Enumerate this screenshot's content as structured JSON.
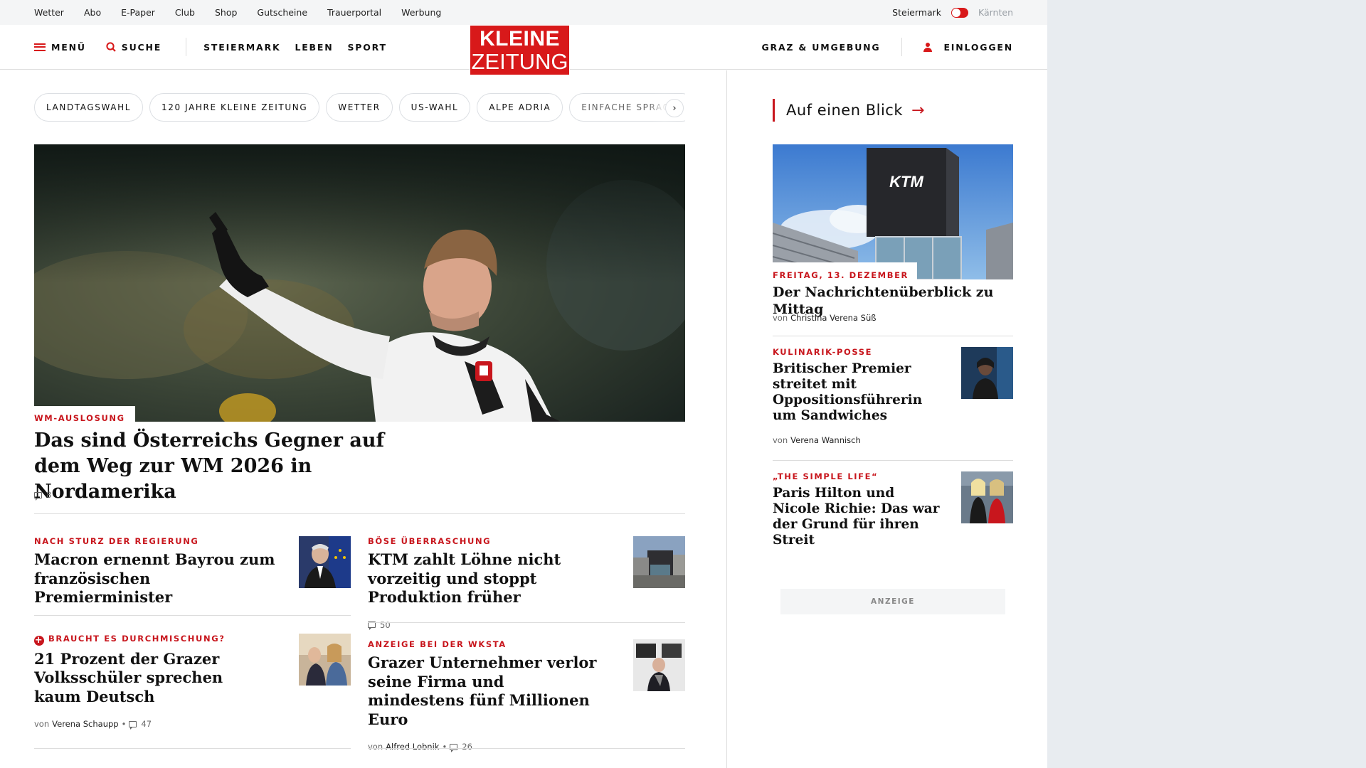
{
  "utility": {
    "links": [
      "Wetter",
      "Abo",
      "E-Paper",
      "Club",
      "Shop",
      "Gutscheine",
      "Trauerportal",
      "Werbung"
    ],
    "region_active": "Steiermark",
    "region_inactive": "Kärnten"
  },
  "header": {
    "menu_label": "MENÜ",
    "search_label": "SUCHE",
    "sections": [
      "STEIERMARK",
      "LEBEN",
      "SPORT"
    ],
    "logo_line1": "KLEINE",
    "logo_line2": "ZEITUNG",
    "region_link": "GRAZ & UMGEBUNG",
    "login_label": "EINLOGGEN"
  },
  "chips": [
    "LANDTAGSWAHL",
    "120 JAHRE KLEINE ZEITUNG",
    "WETTER",
    "US-WAHL",
    "ALPE ADRIA",
    "EINFACHE SPRACHE"
  ],
  "hero": {
    "kicker": "WM-AUSLOSUNG",
    "title": "Das sind Österreichs Gegner auf dem Weg zur WM 2026 in Nordamerika",
    "comments": "8"
  },
  "articles": [
    {
      "kicker": "NACH STURZ DER REGIERUNG",
      "title": "Macron ernennt Bayrou zum französischen Premierminister"
    },
    {
      "kicker": "BÖSE ÜBERRASCHUNG",
      "title": "KTM zahlt Löhne nicht vorzeitig und stoppt Produktion früher",
      "comments": "50"
    },
    {
      "kicker": "BRAUCHT ES DURCHMISCHUNG?",
      "title": "21 Prozent der Grazer Volksschüler sprechen kaum Deutsch",
      "by": "von",
      "author": "Verena Schaupp",
      "comments": "47"
    },
    {
      "kicker": "ANZEIGE BEI DER WKSTA",
      "title": "Grazer Unternehmer verlor seine Firma und mindestens fünf Millionen Euro",
      "by": "von",
      "author": "Alfred Lobnik",
      "comments": "26"
    }
  ],
  "sidebar": {
    "heading": "Auf einen Blick",
    "main": {
      "kicker": "FREITAG, 13. DEZEMBER",
      "title": "Der Nachrichtenüberblick zu Mittag",
      "by": "von",
      "author": "Christina Verena Süß",
      "img_text": "KTM"
    },
    "items": [
      {
        "kicker": "KULINARIK-POSSE",
        "title": "Britischer Premier streitet mit Oppositionsführerin um Sandwiches",
        "by": "von",
        "author": "Verena Wannisch"
      },
      {
        "kicker": "„THE SIMPLE LIFE“",
        "title": "Paris Hilton und Nicole Richie: Das war der Grund für ihren Streit"
      }
    ],
    "ad_label": "ANZEIGE"
  },
  "colors": {
    "brand": "#d8191a",
    "kicker": "#c8161d",
    "page_bg": "#e8ecf0"
  }
}
